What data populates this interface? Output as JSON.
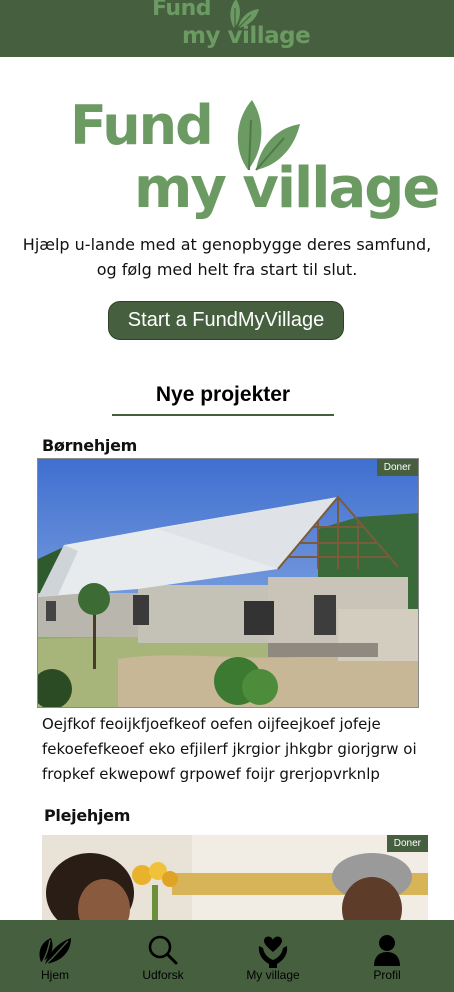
{
  "app": {
    "logo_line1": "Fund",
    "logo_line2": "my village",
    "brand_color": "#46603f",
    "logo_color": "#6c9a63"
  },
  "hero": {
    "tagline": "Hjælp u-lande med at genopbygge deres samfund, og følg med helt fra start til slut.",
    "start_button": "Start a FundMyVillage"
  },
  "projects": {
    "heading": "Nye projekter",
    "items": [
      {
        "title": "Børnehjem",
        "badge": "Doner",
        "description": "Oejfkof feoijkfjoefkeof oefen oijfeejkoef jofeje fekoefefkeoef eko efjilerf jkrgior jhkgbr giorjgrw oi fropkef ekwepowf grpowef foijr grerjopvrknlp"
      },
      {
        "title": "Plejehjem",
        "badge": "Doner"
      }
    ]
  },
  "nav": {
    "items": [
      {
        "label": "Hjem",
        "icon": "leaf-icon"
      },
      {
        "label": "Udforsk",
        "icon": "search-icon"
      },
      {
        "label": "My village",
        "icon": "heart-hands-icon"
      },
      {
        "label": "Profil",
        "icon": "user-icon"
      }
    ]
  }
}
